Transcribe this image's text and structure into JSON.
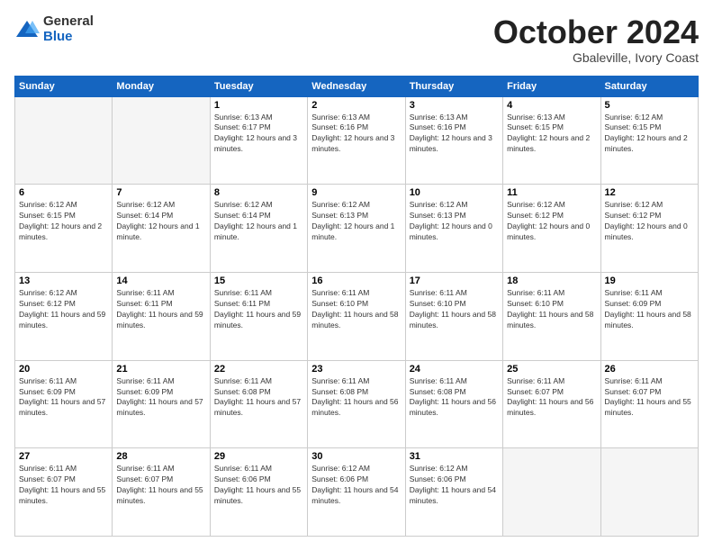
{
  "logo": {
    "general": "General",
    "blue": "Blue"
  },
  "header": {
    "month": "October 2024",
    "location": "Gbaleville, Ivory Coast"
  },
  "days_of_week": [
    "Sunday",
    "Monday",
    "Tuesday",
    "Wednesday",
    "Thursday",
    "Friday",
    "Saturday"
  ],
  "weeks": [
    [
      {
        "day": "",
        "empty": true
      },
      {
        "day": "",
        "empty": true
      },
      {
        "day": "1",
        "sunrise": "Sunrise: 6:13 AM",
        "sunset": "Sunset: 6:17 PM",
        "daylight": "Daylight: 12 hours and 3 minutes."
      },
      {
        "day": "2",
        "sunrise": "Sunrise: 6:13 AM",
        "sunset": "Sunset: 6:16 PM",
        "daylight": "Daylight: 12 hours and 3 minutes."
      },
      {
        "day": "3",
        "sunrise": "Sunrise: 6:13 AM",
        "sunset": "Sunset: 6:16 PM",
        "daylight": "Daylight: 12 hours and 3 minutes."
      },
      {
        "day": "4",
        "sunrise": "Sunrise: 6:13 AM",
        "sunset": "Sunset: 6:15 PM",
        "daylight": "Daylight: 12 hours and 2 minutes."
      },
      {
        "day": "5",
        "sunrise": "Sunrise: 6:12 AM",
        "sunset": "Sunset: 6:15 PM",
        "daylight": "Daylight: 12 hours and 2 minutes."
      }
    ],
    [
      {
        "day": "6",
        "sunrise": "Sunrise: 6:12 AM",
        "sunset": "Sunset: 6:15 PM",
        "daylight": "Daylight: 12 hours and 2 minutes."
      },
      {
        "day": "7",
        "sunrise": "Sunrise: 6:12 AM",
        "sunset": "Sunset: 6:14 PM",
        "daylight": "Daylight: 12 hours and 1 minute."
      },
      {
        "day": "8",
        "sunrise": "Sunrise: 6:12 AM",
        "sunset": "Sunset: 6:14 PM",
        "daylight": "Daylight: 12 hours and 1 minute."
      },
      {
        "day": "9",
        "sunrise": "Sunrise: 6:12 AM",
        "sunset": "Sunset: 6:13 PM",
        "daylight": "Daylight: 12 hours and 1 minute."
      },
      {
        "day": "10",
        "sunrise": "Sunrise: 6:12 AM",
        "sunset": "Sunset: 6:13 PM",
        "daylight": "Daylight: 12 hours and 0 minutes."
      },
      {
        "day": "11",
        "sunrise": "Sunrise: 6:12 AM",
        "sunset": "Sunset: 6:12 PM",
        "daylight": "Daylight: 12 hours and 0 minutes."
      },
      {
        "day": "12",
        "sunrise": "Sunrise: 6:12 AM",
        "sunset": "Sunset: 6:12 PM",
        "daylight": "Daylight: 12 hours and 0 minutes."
      }
    ],
    [
      {
        "day": "13",
        "sunrise": "Sunrise: 6:12 AM",
        "sunset": "Sunset: 6:12 PM",
        "daylight": "Daylight: 11 hours and 59 minutes."
      },
      {
        "day": "14",
        "sunrise": "Sunrise: 6:11 AM",
        "sunset": "Sunset: 6:11 PM",
        "daylight": "Daylight: 11 hours and 59 minutes."
      },
      {
        "day": "15",
        "sunrise": "Sunrise: 6:11 AM",
        "sunset": "Sunset: 6:11 PM",
        "daylight": "Daylight: 11 hours and 59 minutes."
      },
      {
        "day": "16",
        "sunrise": "Sunrise: 6:11 AM",
        "sunset": "Sunset: 6:10 PM",
        "daylight": "Daylight: 11 hours and 58 minutes."
      },
      {
        "day": "17",
        "sunrise": "Sunrise: 6:11 AM",
        "sunset": "Sunset: 6:10 PM",
        "daylight": "Daylight: 11 hours and 58 minutes."
      },
      {
        "day": "18",
        "sunrise": "Sunrise: 6:11 AM",
        "sunset": "Sunset: 6:10 PM",
        "daylight": "Daylight: 11 hours and 58 minutes."
      },
      {
        "day": "19",
        "sunrise": "Sunrise: 6:11 AM",
        "sunset": "Sunset: 6:09 PM",
        "daylight": "Daylight: 11 hours and 58 minutes."
      }
    ],
    [
      {
        "day": "20",
        "sunrise": "Sunrise: 6:11 AM",
        "sunset": "Sunset: 6:09 PM",
        "daylight": "Daylight: 11 hours and 57 minutes."
      },
      {
        "day": "21",
        "sunrise": "Sunrise: 6:11 AM",
        "sunset": "Sunset: 6:09 PM",
        "daylight": "Daylight: 11 hours and 57 minutes."
      },
      {
        "day": "22",
        "sunrise": "Sunrise: 6:11 AM",
        "sunset": "Sunset: 6:08 PM",
        "daylight": "Daylight: 11 hours and 57 minutes."
      },
      {
        "day": "23",
        "sunrise": "Sunrise: 6:11 AM",
        "sunset": "Sunset: 6:08 PM",
        "daylight": "Daylight: 11 hours and 56 minutes."
      },
      {
        "day": "24",
        "sunrise": "Sunrise: 6:11 AM",
        "sunset": "Sunset: 6:08 PM",
        "daylight": "Daylight: 11 hours and 56 minutes."
      },
      {
        "day": "25",
        "sunrise": "Sunrise: 6:11 AM",
        "sunset": "Sunset: 6:07 PM",
        "daylight": "Daylight: 11 hours and 56 minutes."
      },
      {
        "day": "26",
        "sunrise": "Sunrise: 6:11 AM",
        "sunset": "Sunset: 6:07 PM",
        "daylight": "Daylight: 11 hours and 55 minutes."
      }
    ],
    [
      {
        "day": "27",
        "sunrise": "Sunrise: 6:11 AM",
        "sunset": "Sunset: 6:07 PM",
        "daylight": "Daylight: 11 hours and 55 minutes."
      },
      {
        "day": "28",
        "sunrise": "Sunrise: 6:11 AM",
        "sunset": "Sunset: 6:07 PM",
        "daylight": "Daylight: 11 hours and 55 minutes."
      },
      {
        "day": "29",
        "sunrise": "Sunrise: 6:11 AM",
        "sunset": "Sunset: 6:06 PM",
        "daylight": "Daylight: 11 hours and 55 minutes."
      },
      {
        "day": "30",
        "sunrise": "Sunrise: 6:12 AM",
        "sunset": "Sunset: 6:06 PM",
        "daylight": "Daylight: 11 hours and 54 minutes."
      },
      {
        "day": "31",
        "sunrise": "Sunrise: 6:12 AM",
        "sunset": "Sunset: 6:06 PM",
        "daylight": "Daylight: 11 hours and 54 minutes."
      },
      {
        "day": "",
        "empty": true
      },
      {
        "day": "",
        "empty": true
      }
    ]
  ]
}
